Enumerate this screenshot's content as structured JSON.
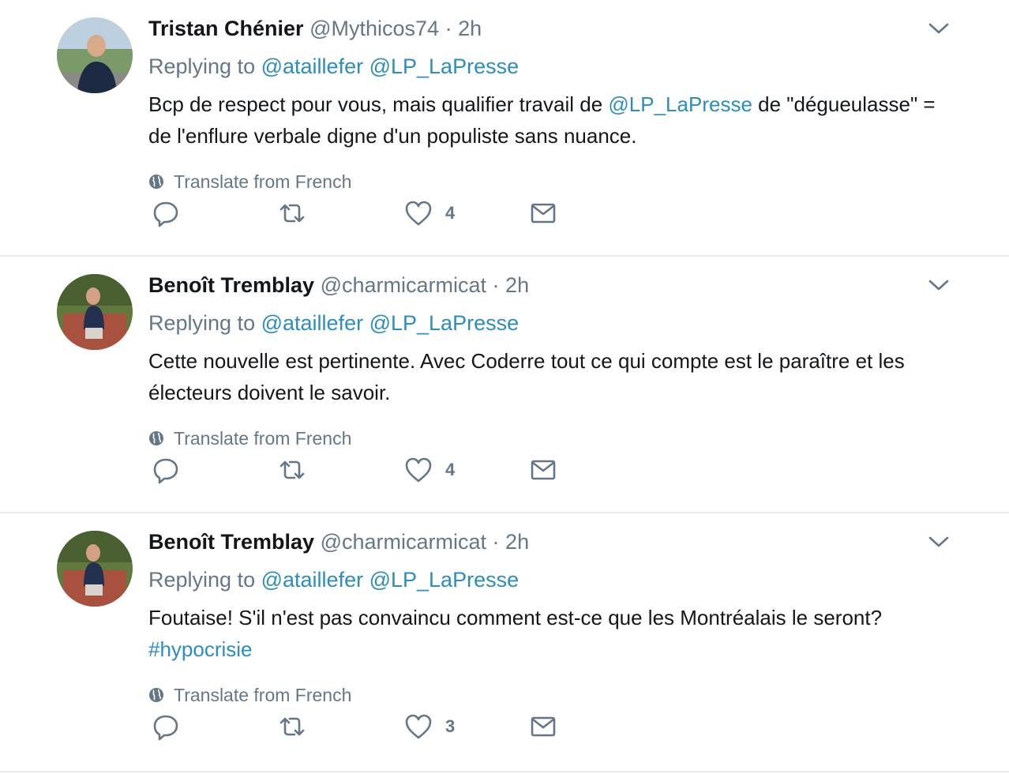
{
  "tweets": [
    {
      "fullname": "Tristan Chénier",
      "screenname": "@Mythicos74",
      "separator": "·",
      "time": "2h",
      "replying_prefix": "Replying to",
      "replying_to": [
        "@ataillefer",
        "@LP_LaPresse"
      ],
      "text_parts": [
        {
          "text": "Bcp de respect pour vous, mais qualifier travail de ",
          "link": false
        },
        {
          "text": "@LP_LaPresse",
          "link": true
        },
        {
          "text": " de \"dégueulasse\" = de l'enflure verbale digne d'un populiste sans nuance.",
          "link": false
        }
      ],
      "translate_label": "Translate from French",
      "like_count": "4"
    },
    {
      "fullname": "Benoît Tremblay",
      "screenname": "@charmicarmicat",
      "separator": "·",
      "time": "2h",
      "replying_prefix": "Replying to",
      "replying_to": [
        "@ataillefer",
        "@LP_LaPresse"
      ],
      "text_parts": [
        {
          "text": "Cette nouvelle est pertinente. Avec Coderre tout ce qui compte est le paraître et les électeurs doivent le savoir.",
          "link": false
        }
      ],
      "translate_label": "Translate from French",
      "like_count": "4"
    },
    {
      "fullname": "Benoît Tremblay",
      "screenname": "@charmicarmicat",
      "separator": "·",
      "time": "2h",
      "replying_prefix": "Replying to",
      "replying_to": [
        "@ataillefer",
        "@LP_LaPresse"
      ],
      "text_parts": [
        {
          "text": "Foutaise! S'il n'est pas convaincu comment est-ce que les Montréalais le seront? ",
          "link": false
        },
        {
          "text": "#hypocrisie",
          "link": true
        }
      ],
      "translate_label": "Translate from French",
      "like_count": "3"
    }
  ],
  "icons": {
    "reply": "reply-icon",
    "retweet": "retweet-icon",
    "like": "heart-icon",
    "dm": "envelope-icon",
    "caret": "chevron-down-icon",
    "globe": "globe-icon"
  },
  "colors": {
    "link": "#2b8dc2",
    "secondary_text": "#657786",
    "icon": "#657786",
    "divider": "#e6ecf0"
  }
}
